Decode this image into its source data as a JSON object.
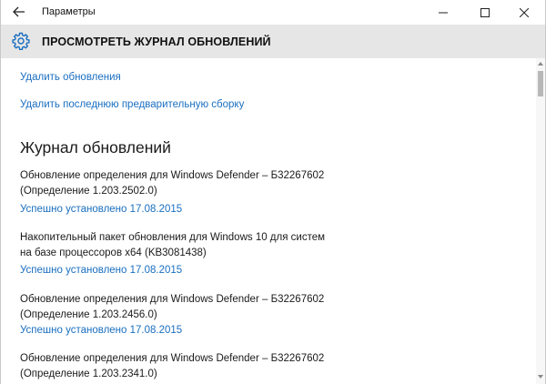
{
  "window": {
    "app_title": "Параметры",
    "controls": {
      "minimize": "minimize-icon",
      "maximize": "maximize-icon",
      "close": "close-icon"
    },
    "back": "back-arrow-icon"
  },
  "header": {
    "icon": "gear-icon",
    "title": "ПРОСМОТРЕТЬ ЖУРНАЛ ОБНОВЛЕНИЙ"
  },
  "actions": {
    "uninstall_updates": "Удалить обновления",
    "uninstall_preview": "Удалить последнюю предварительную сборку"
  },
  "history": {
    "title": "Журнал обновлений",
    "entries": [
      {
        "line1": "Обновление определения для Windows Defender – Б32267602",
        "line2": "(Определение 1.203.2502.0)",
        "status": "Успешно установлено 17.08.2015"
      },
      {
        "line1": "Накопительный пакет обновления для Windows 10 для систем",
        "line2": "на базе процессоров x64 (KB3081438)",
        "status": "Успешно установлено 17.08.2015"
      },
      {
        "line1": "Обновление определения для Windows Defender – Б32267602",
        "line2": "(Определение 1.203.2456.0)",
        "status": "Успешно установлено 17.08.2015"
      },
      {
        "line1": "Обновление определения для Windows Defender – Б32267602",
        "line2": "(Определение 1.203.2341.0)",
        "status": ""
      }
    ]
  },
  "colors": {
    "link": "#1a6fc0",
    "header_bg": "#e6e6e6",
    "text": "#1a1a1a"
  }
}
